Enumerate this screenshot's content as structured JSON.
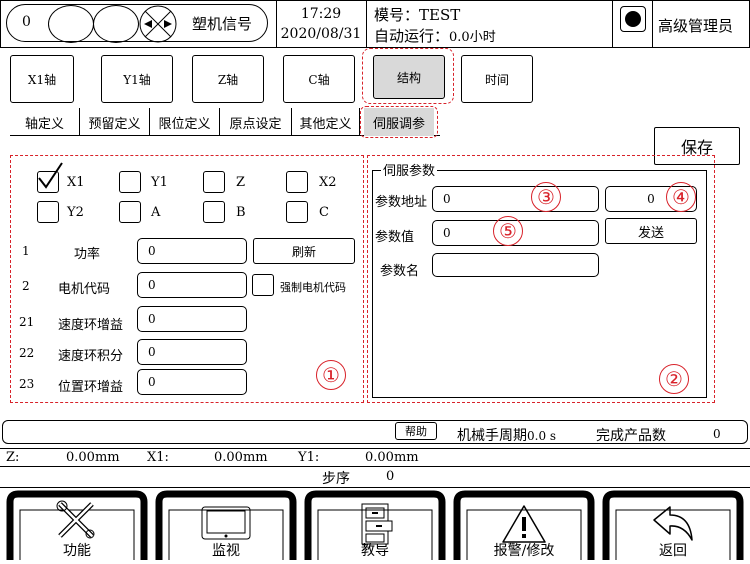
{
  "header": {
    "counter": "0",
    "machine_signal": "塑机信号",
    "time": "17:29",
    "date": "2020/08/31",
    "mold_label": "模号：",
    "mold_value": "TEST",
    "auto_run_label": "自动运行：",
    "auto_run_value": "0.0小时",
    "user": "高级管理员"
  },
  "axis_tabs": [
    {
      "label": "X1轴"
    },
    {
      "label": "Y1轴"
    },
    {
      "label": "Z轴"
    },
    {
      "label": "C轴"
    },
    {
      "label": "结构"
    },
    {
      "label": "时间"
    }
  ],
  "sub_tabs": [
    {
      "label": "轴定义"
    },
    {
      "label": "预留定义"
    },
    {
      "label": "限位定义"
    },
    {
      "label": "原点设定"
    },
    {
      "label": "其他定义"
    },
    {
      "label": "伺服调参"
    }
  ],
  "save_label": "保存",
  "axes_select": [
    {
      "label": "X1",
      "checked": true
    },
    {
      "label": "Y1",
      "checked": false
    },
    {
      "label": "Z",
      "checked": false
    },
    {
      "label": "X2",
      "checked": false
    },
    {
      "label": "Y2",
      "checked": false
    },
    {
      "label": "A",
      "checked": false
    },
    {
      "label": "B",
      "checked": false
    },
    {
      "label": "C",
      "checked": false
    }
  ],
  "params": [
    {
      "num": "1",
      "name": "功率",
      "value": "0"
    },
    {
      "num": "2",
      "name": "电机代码",
      "value": "0"
    },
    {
      "num": "21",
      "name": "速度环增益",
      "value": "0"
    },
    {
      "num": "22",
      "name": "速度环积分",
      "value": "0"
    },
    {
      "num": "23",
      "name": "位置环增益",
      "value": "0"
    }
  ],
  "refresh_label": "刷新",
  "force_motor_code_label": "强制电机代码",
  "servo": {
    "title": "伺服参数",
    "addr_label": "参数地址",
    "addr_value": "0",
    "addr_value2": "0",
    "val_label": "参数值",
    "val_value": "0",
    "send_label": "发送",
    "name_label": "参数名",
    "name_value": ""
  },
  "annotations": [
    "①",
    "②",
    "③",
    "④",
    "⑤"
  ],
  "status": {
    "help_label": "帮助",
    "cycle_label": "机械手周期",
    "cycle_value": "0.0 s",
    "product_label": "完成产品数",
    "product_value": "0"
  },
  "positions": {
    "z_label": "Z:",
    "z_value": "0.00mm",
    "x1_label": "X1:",
    "x1_value": "0.00mm",
    "y1_label": "Y1:",
    "y1_value": "0.00mm"
  },
  "step": {
    "label": "步序",
    "value": "0"
  },
  "nav": [
    {
      "label": "功能",
      "icon": "tools-icon"
    },
    {
      "label": "监视",
      "icon": "monitor-icon"
    },
    {
      "label": "教导",
      "icon": "cabinet-icon"
    },
    {
      "label": "报警/修改",
      "icon": "warning-icon"
    },
    {
      "label": "返回",
      "icon": "return-icon"
    }
  ]
}
